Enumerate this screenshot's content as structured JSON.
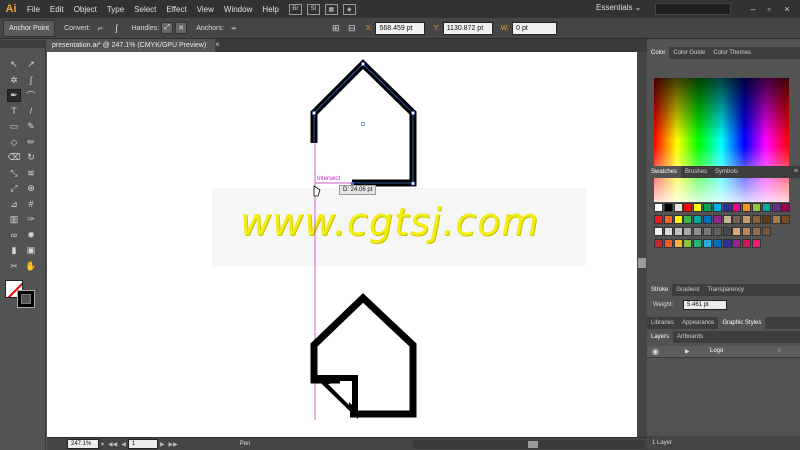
{
  "app": {
    "logo": "Ai",
    "workspace": "Essentials ⌄"
  },
  "menu": [
    "File",
    "Edit",
    "Object",
    "Type",
    "Select",
    "Effect",
    "View",
    "Window",
    "Help"
  ],
  "menu_boxes": [
    "Br",
    "St"
  ],
  "control_bar": {
    "tool_name": "Anchor Point",
    "convert_label": "Convert:",
    "handles_label": "Handles:",
    "anchors_label": "Anchors:",
    "x_label": "X:",
    "x_value": "568.459 pt",
    "y_label": "Y:",
    "y_value": "1130.872 pt",
    "w_label": "W:",
    "w_value": "0 pt"
  },
  "document": {
    "tab_title": "presentation.ai* @ 247.1% (CMYK/GPU Preview)",
    "close": "×",
    "smart_guide_label": "Intersect",
    "measure_label": "D: 24.06 pt",
    "watermark": "www.cgtsj.com"
  },
  "status_bar": {
    "zoom": "247.1%",
    "artboard": "1",
    "tool": "Pen"
  },
  "panels": {
    "color_tabs": [
      "Color",
      "Color Guide",
      "Color Themes"
    ],
    "swatch_tabs": [
      "Swatches",
      "Brushes",
      "Symbols"
    ],
    "stroke_tabs": [
      "Stroke",
      "Gradient",
      "Transparency"
    ],
    "weight_label": "Weight:",
    "weight_value": "5.461 pt",
    "library_tabs": [
      "Libraries",
      "Appearance",
      "Graphic Styles"
    ],
    "layer_tabs": [
      "Layers",
      "Artboards"
    ],
    "layer_name": "Logo",
    "layer_count": "1 Layer"
  },
  "colors": {
    "accent_orange": "#f09a30",
    "smart_guide": "#c020c0",
    "watermark": "#f2ee12",
    "selection_blue": "#3a6fd8"
  },
  "swatch_colors": [
    [
      "#ffffff",
      "#000000",
      "#e5e5e5",
      "#ff0000",
      "#ffff00",
      "#00a651",
      "#00aeef",
      "#2e3192",
      "#ec008c",
      "#f7941d",
      "#8dc63f",
      "#00a99d",
      "#662d91",
      "#9e005d"
    ],
    [
      "#ed1c24",
      "#f26522",
      "#fff200",
      "#39b54a",
      "#00a79d",
      "#0072bc",
      "#92278f",
      "#c7b299",
      "#736357",
      "#c69c6d",
      "#8c6239",
      "#603913",
      "#a67c52",
      "#754c24"
    ],
    [
      "#f2f2f2",
      "#dadada",
      "#c2c2c2",
      "#aaaaaa",
      "#929292",
      "#7a7a7a",
      "#626262",
      "#4a4a4a",
      "#d7a97d",
      "#b9855f",
      "#996d4a",
      "#7b5637"
    ],
    [
      "#c1272d",
      "#f15a24",
      "#fbb03b",
      "#8cc63f",
      "#22b573",
      "#29abe2",
      "#0071bc",
      "#2e3192",
      "#93278f",
      "#d4145a",
      "#ed1e79"
    ]
  ],
  "icons": {
    "tools": [
      "selection-icon",
      "direct-selection-icon",
      "magic-wand-icon",
      "lasso-icon",
      "pen-icon",
      "curvature-icon",
      "type-icon",
      "line-icon",
      "rectangle-icon",
      "paintbrush-icon",
      "shaper-icon",
      "pencil-icon",
      "eraser-icon",
      "rotate-icon",
      "scale-icon",
      "width-icon",
      "free-transform-icon",
      "shape-builder-icon",
      "perspective-icon",
      "mesh-icon",
      "gradient-icon",
      "eyedropper-icon",
      "blend-icon",
      "symbol-sprayer-icon",
      "column-graph-icon",
      "artboard-icon",
      "slice-icon",
      "hand-icon",
      "zoom-icon"
    ]
  }
}
